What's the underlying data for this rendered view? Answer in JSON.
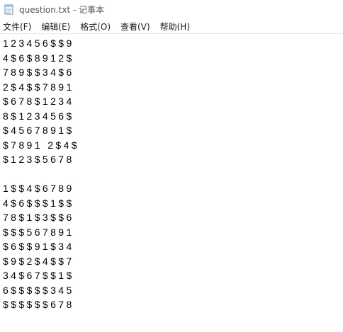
{
  "window": {
    "title": "question.txt - 记事本"
  },
  "menu": [
    {
      "label": "文件(F)"
    },
    {
      "label": "编辑(E)"
    },
    {
      "label": "格式(O)"
    },
    {
      "label": "查看(V)"
    },
    {
      "label": "帮助(H)"
    }
  ],
  "content": {
    "lines": [
      "123456$$9",
      "4$6$8912$",
      "789$$34$6",
      "2$4$$7891",
      "$678$1234",
      "8$123456$",
      "$4567891$",
      "$7891 2$4$",
      "$123$5678",
      "",
      "1$$4$6789",
      "4$6$$$1$$",
      "78$1$3$$6",
      "$$$567891",
      "$6$$91$34",
      "$9$2$4$$7",
      "34$67$$1$",
      "6$$$$$345",
      "$$$$$$678"
    ]
  }
}
